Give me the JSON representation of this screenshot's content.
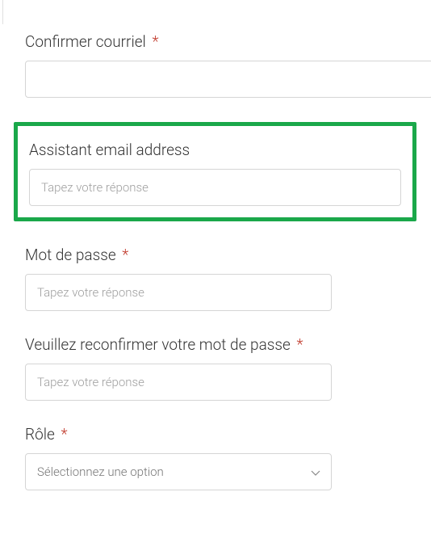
{
  "fields": {
    "confirm_email": {
      "label": "Confirmer courriel",
      "required": true,
      "placeholder": ""
    },
    "assistant_email": {
      "label": "Assistant email address",
      "required": false,
      "placeholder": "Tapez votre réponse"
    },
    "password": {
      "label": "Mot de passe",
      "required": true,
      "placeholder": "Tapez votre réponse"
    },
    "confirm_password": {
      "label": "Veuillez reconfirmer votre mot de passe",
      "required": true,
      "placeholder": "Tapez votre réponse"
    },
    "role": {
      "label": "Rôle",
      "required": true,
      "placeholder": "Sélectionnez une option"
    }
  },
  "required_marker": "*"
}
